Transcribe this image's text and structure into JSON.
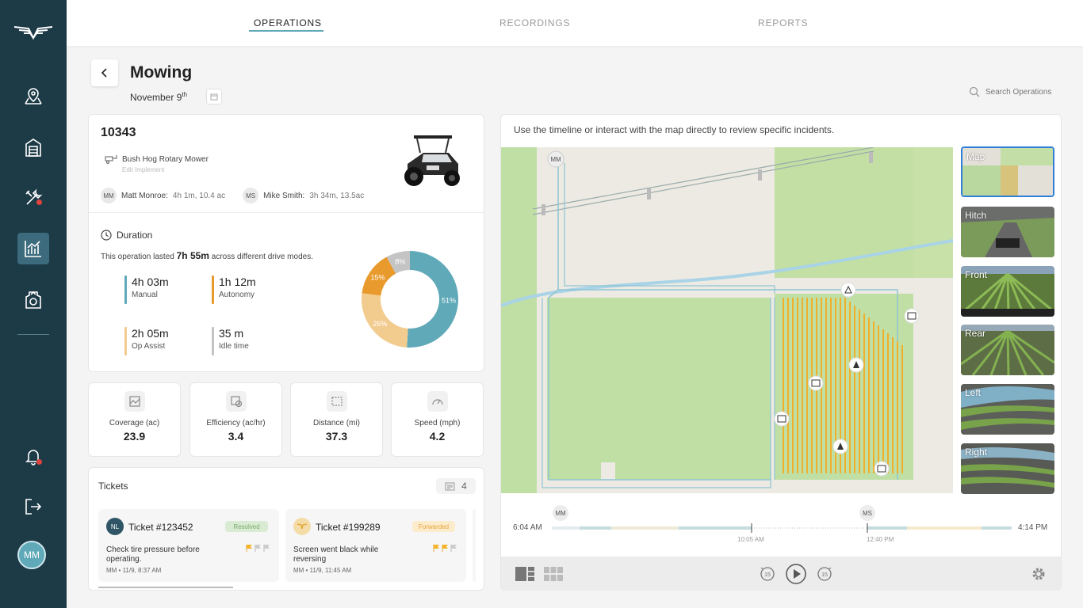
{
  "nav": {
    "tabs": [
      {
        "label": "OPERATIONS",
        "active": true
      },
      {
        "label": "RECORDINGS",
        "active": false
      },
      {
        "label": "REPORTS",
        "active": false
      }
    ]
  },
  "sidebar": {
    "icons": [
      "logo-wings-icon",
      "map-pin-icon",
      "garage-icon",
      "tools-icon",
      "analytics-icon",
      "tractor-badge-icon",
      "bell-icon",
      "logout-icon"
    ],
    "avatar_initials": "MM",
    "accent": "#1d3a47"
  },
  "header": {
    "title": "Mowing",
    "date": "November 9",
    "date_suffix": "th",
    "search_placeholder": "Search Operations"
  },
  "operation": {
    "id": "10343",
    "implement": "Bush Hog Rotary Mower",
    "implement_edit": "Edit Implement",
    "operators": [
      {
        "initials": "MM",
        "name": "Matt Monroe:",
        "stats": "4h 1m, 10.4 ac"
      },
      {
        "initials": "MS",
        "name": "Mike Smith:",
        "stats": "3h 34m, 13.5ac"
      }
    ],
    "duration": {
      "heading": "Duration",
      "text_before": "This operation lasted ",
      "total": "7h 55m",
      "text_after": " across different drive modes.",
      "modes": [
        {
          "value": "4h 03m",
          "label": "Manual",
          "color": "#5fa9b8"
        },
        {
          "value": "1h 12m",
          "label": "Autonomy",
          "color": "#e99a2c"
        },
        {
          "value": "2h 05m",
          "label": "Op Assist",
          "color": "#f2cc8f"
        },
        {
          "value": "35 m",
          "label": "Idle time",
          "color": "#c4c4c4"
        }
      ],
      "donut": [
        {
          "label": "51%",
          "pct": 51,
          "color": "#5fa9b8"
        },
        {
          "label": "26%",
          "pct": 26,
          "color": "#f2cc8f"
        },
        {
          "label": "15%",
          "pct": 15,
          "color": "#e99a2c"
        },
        {
          "label": "8%",
          "pct": 8,
          "color": "#c4c4c4"
        }
      ]
    }
  },
  "stats": [
    {
      "label": "Coverage (ac)",
      "value": "23.9",
      "icon": "coverage-icon"
    },
    {
      "label": "Efficiency (ac/hr)",
      "value": "3.4",
      "icon": "efficiency-icon"
    },
    {
      "label": "Distance (mi)",
      "value": "37.3",
      "icon": "distance-icon"
    },
    {
      "label": "Speed (mph)",
      "value": "4.2",
      "icon": "speed-icon"
    }
  ],
  "tickets": {
    "title": "Tickets",
    "count": "4",
    "items": [
      {
        "initials": "NL",
        "name": "Ticket #123452",
        "status": "Resolved",
        "message": "Check tire pressure before operating.",
        "meta": "MM  •  11/9, 8:37 AM"
      },
      {
        "initials": "",
        "name": "Ticket #199289",
        "status": "Forwarded",
        "message": "Screen went black while reversing",
        "meta": "MM  •  11/9, 11:45 AM"
      }
    ]
  },
  "map": {
    "hint": "Use the timeline or interact with the map directly to review specific incidents.",
    "marker_initials": "MM",
    "views": [
      "Map",
      "Hitch",
      "Front",
      "Rear",
      "Left",
      "Right"
    ],
    "selected_view": "Map"
  },
  "timeline": {
    "start": "6:04 AM",
    "end": "4:14 PM",
    "mark1": "10:05 AM",
    "mark2": "12:40 PM",
    "op1": "MM",
    "op2": "MS"
  }
}
